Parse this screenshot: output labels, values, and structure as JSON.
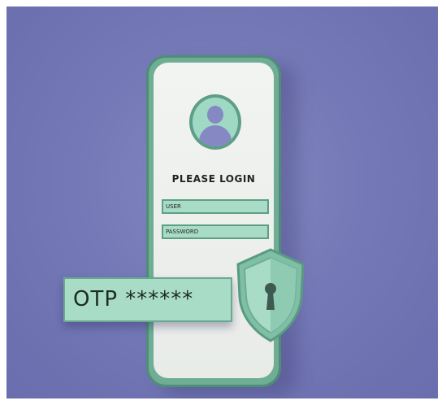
{
  "login": {
    "title": "PLEASE LOGIN",
    "user_label": "USER",
    "password_label": "PASSWORD"
  },
  "otp": {
    "label": "OTP ******"
  },
  "colors": {
    "background": "#7579b6",
    "accent_mint": "#a9dcc6",
    "accent_green": "#5f9e86",
    "avatar_figure": "#8688c3"
  },
  "icons": [
    "user-avatar-icon",
    "shield-lock-icon"
  ]
}
